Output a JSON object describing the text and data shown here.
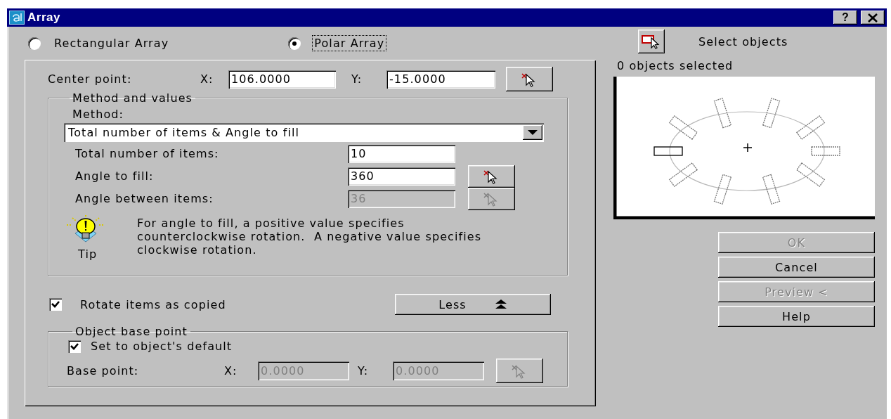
{
  "window": {
    "title": "Array",
    "help_glyph": "?"
  },
  "array_types": [
    {
      "label": "Rectangular Array",
      "selected": false,
      "focused": false
    },
    {
      "label": "Polar Array",
      "selected": true,
      "focused": true
    }
  ],
  "center_point": {
    "label": "Center point:",
    "x_label": "X:",
    "x_value": "106.0000",
    "y_label": "Y:",
    "y_value": "-15.0000"
  },
  "method_and_values": {
    "title": "Method and values",
    "method_label": "Method:",
    "method_value": "Total number of items & Angle to fill",
    "fields": [
      {
        "label": "Total number of items:",
        "value": "10",
        "disabled": false,
        "pick_button": false
      },
      {
        "label": "Angle to fill:",
        "value": "360",
        "disabled": false,
        "pick_button": true
      },
      {
        "label": "Angle between items:",
        "value": "36",
        "disabled": true,
        "pick_button": true
      }
    ],
    "tip": {
      "label": "Tip",
      "text": "For angle to fill, a positive value specifies counterclockwise rotation.  A negative value specifies clockwise rotation."
    }
  },
  "rotate": {
    "label": "Rotate items as copied",
    "checked": true
  },
  "less_button": {
    "label": "Less"
  },
  "object_base_point": {
    "title": "Object base point",
    "default_label": "Set to object's default",
    "default_checked": true,
    "base_point_label": "Base point:",
    "x_label": "X:",
    "x_value": "0.0000",
    "y_label": "Y:",
    "y_value": "0.0000",
    "disabled": true
  },
  "select_objects": {
    "label": "Select objects",
    "status": "0 objects selected"
  },
  "buttons": [
    {
      "label": "OK",
      "disabled": true
    },
    {
      "label": "Cancel",
      "disabled": false
    },
    {
      "label": "Preview <",
      "disabled": true
    },
    {
      "label": "Help",
      "disabled": false
    }
  ]
}
